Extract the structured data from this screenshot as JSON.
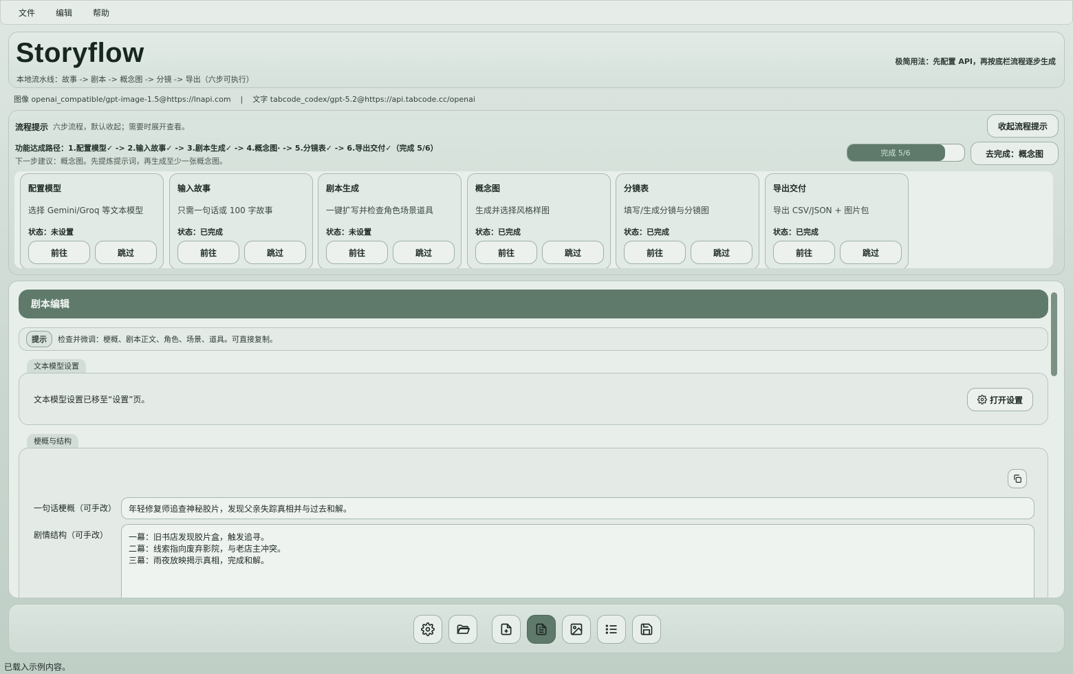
{
  "menu": [
    "文件",
    "编辑",
    "帮助"
  ],
  "header": {
    "title": "Storyflow",
    "subtitle": "本地流水线：故事 -> 剧本 -> 概念图 -> 分镜 -> 导出（六步可执行）",
    "quick_usage": "极简用法：先配置 API，再按底栏流程逐步生成"
  },
  "model_info": {
    "image": "图像 openai_compatible/gpt-image-1.5@https://lnapi.com",
    "separator": "|",
    "text": "文字 tabcode_codex/gpt-5.2@https://api.tabcode.cc/openai"
  },
  "flow": {
    "label": "流程提示",
    "desc": "六步流程，默认收起；需要时展开查看。",
    "collapse_label": "收起流程提示",
    "path": "功能达成路径：1.配置模型✓ -> 2.输入故事✓ -> 3.剧本生成✓ -> 4.概念图· -> 5.分镜表✓ -> 6.导出交付✓（完成 5/6）",
    "next": "下一步建议：概念图。先提炼提示词，再生成至少一张概念图。",
    "progress_label": "完成 5/6",
    "progress": 0.833,
    "goto_label": "去完成：概念图",
    "steps": [
      {
        "title": "配置模型",
        "desc": "选择 Gemini/Groq 等文本模型",
        "status": "状态：未设置",
        "go": "前往",
        "skip": "跳过"
      },
      {
        "title": "输入故事",
        "desc": "只需一句话或 100 字故事",
        "status": "状态：已完成",
        "go": "前往",
        "skip": "跳过"
      },
      {
        "title": "剧本生成",
        "desc": "一键扩写并检查角色场景道具",
        "status": "状态：未设置",
        "go": "前往",
        "skip": "跳过"
      },
      {
        "title": "概念图",
        "desc": "生成并选择风格样图",
        "status": "状态：已完成",
        "go": "前往",
        "skip": "跳过"
      },
      {
        "title": "分镜表",
        "desc": "填写/生成分镜与分镜图",
        "status": "状态：已完成",
        "go": "前往",
        "skip": "跳过"
      },
      {
        "title": "导出交付",
        "desc": "导出 CSV/JSON + 图片包",
        "status": "状态：已完成",
        "go": "前往",
        "skip": "跳过"
      }
    ]
  },
  "editor": {
    "section_title": "剧本编辑",
    "hint_badge": "提示",
    "hint_text": "检查并微调：梗概、剧本正文、角色、场景、道具。可直接复制。",
    "model_group": {
      "tab": "文本模型设置",
      "text": "文本模型设置已移至“设置”页。",
      "button": "打开设置"
    },
    "synopsis_group": {
      "tab": "梗概与结构",
      "logline_label": "一句话梗概（可手改）",
      "logline_value": "年轻修复师追查神秘胶片，发现父亲失踪真相并与过去和解。",
      "structure_label": "剧情结构（可手改）",
      "structure_lines": [
        "一幕：旧书店发现胶片盒，触发追寻。",
        "二幕：线索指向废弃影院，与老店主冲突。",
        "三幕：雨夜放映揭示真相，完成和解。"
      ]
    }
  },
  "toolbar": {
    "buttons": [
      "gear-icon",
      "folder-open-icon",
      "file-plus-icon",
      "file-text-icon",
      "image-icon",
      "list-icon",
      "save-icon"
    ],
    "active": "file-text-icon"
  },
  "status": "已载入示例内容。",
  "colors": {
    "accent": "#5f7a6b",
    "background": "#dfe7e2"
  }
}
